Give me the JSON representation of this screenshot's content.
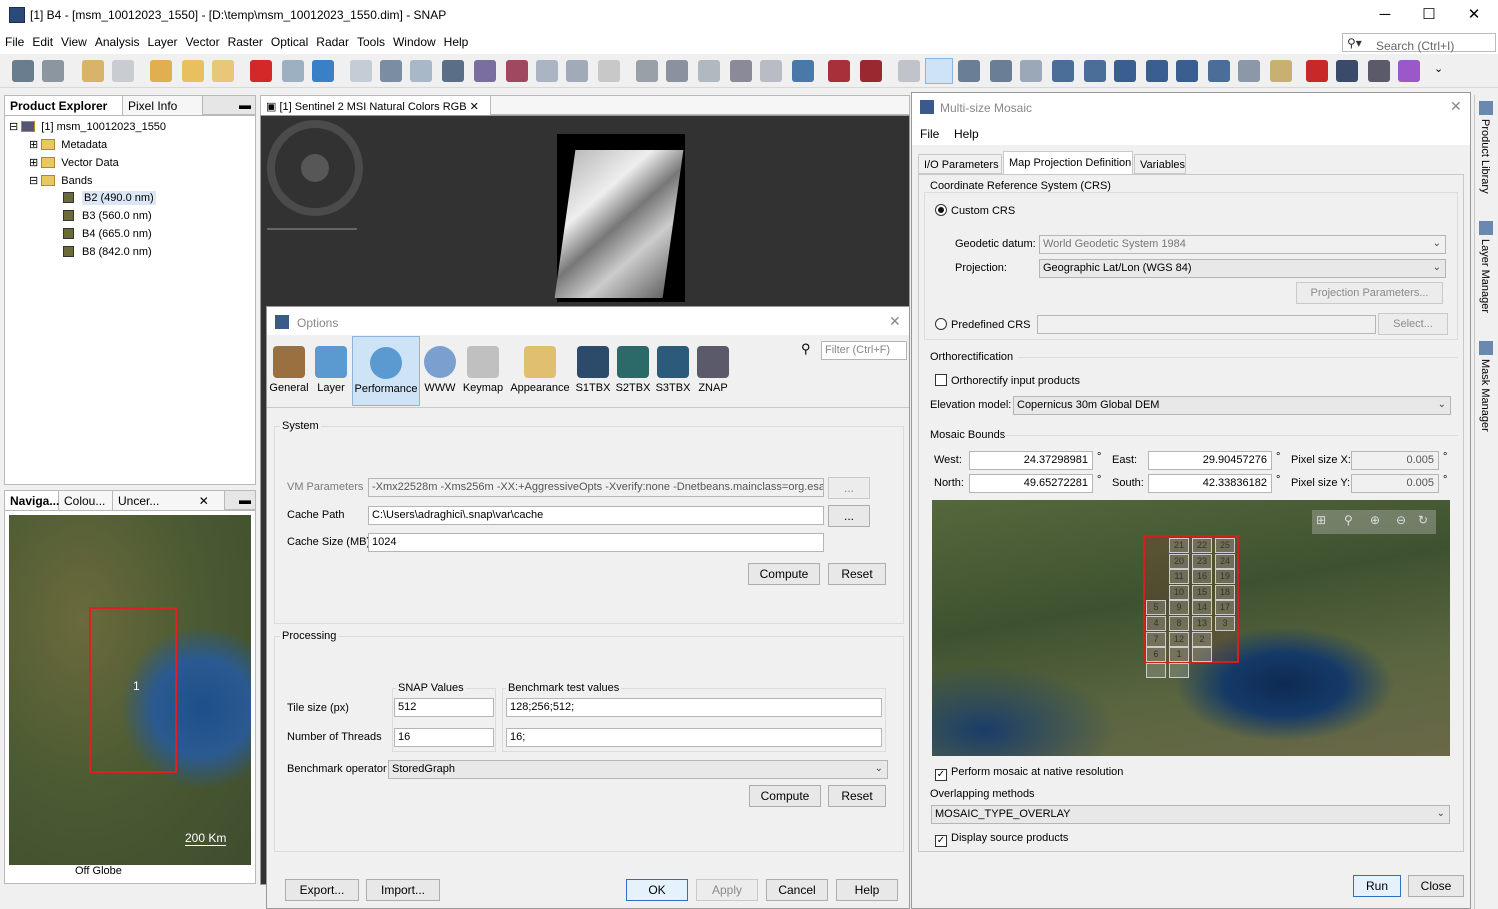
{
  "window": {
    "title": "[1] B4 - [msm_10012023_1550] - [D:\\temp\\msm_10012023_1550.dim] - SNAP",
    "minimize": "─",
    "maximize": "☐",
    "close": "✕"
  },
  "menu": [
    "File",
    "Edit",
    "View",
    "Analysis",
    "Layer",
    "Vector",
    "Raster",
    "Optical",
    "Radar",
    "Tools",
    "Window",
    "Help"
  ],
  "search": {
    "placeholder": "Search (Ctrl+I)",
    "icon": "search-icon"
  },
  "product_explorer": {
    "tabs": [
      "Product Explorer",
      "Pixel Info"
    ],
    "root": "[1] msm_10012023_1550",
    "folders": [
      "Metadata",
      "Vector Data",
      "Bands"
    ],
    "bands": [
      "B2 (490.0 nm)",
      "B3 (560.0 nm)",
      "B4 (665.0 nm)",
      "B8 (842.0 nm)"
    ]
  },
  "navigation": {
    "tabs": [
      "Naviga...",
      "Colou...",
      "Uncer..."
    ],
    "scale": "200 Km",
    "footer": "Off Globe",
    "region_label": "1"
  },
  "image_view": {
    "tab": "[1] Sentinel 2 MSI Natural Colors RGB"
  },
  "options": {
    "title": "Options",
    "filter_placeholder": "Filter (Ctrl+F)",
    "categories": [
      "General",
      "Layer",
      "Performance",
      "WWW",
      "Keymap",
      "Appearance",
      "S1TBX",
      "S2TBX",
      "S3TBX",
      "ZNAP"
    ],
    "system": {
      "title": "System",
      "vm_label": "VM Parameters",
      "vm_value": "-Xmx22528m -Xms256m -XX:+AggressiveOpts -Xverify:none -Dnetbeans.mainclass=org.esa.",
      "cache_path_label": "Cache Path",
      "cache_path_value": "C:\\Users\\adraghici\\.snap\\var\\cache",
      "cache_size_label": "Cache Size (MB)",
      "cache_size_value": "1024",
      "browse": "...",
      "compute": "Compute",
      "reset": "Reset"
    },
    "processing": {
      "title": "Processing",
      "snap_values": "SNAP Values",
      "benchmark_values": "Benchmark test values",
      "tile_label": "Tile size (px)",
      "tile_value": "512",
      "tile_bench": "128;256;512;",
      "threads_label": "Number of Threads",
      "threads_value": "16",
      "threads_bench": "16;",
      "op_label": "Benchmark operator",
      "op_value": "StoredGraph",
      "compute": "Compute",
      "reset": "Reset"
    },
    "buttons": {
      "export": "Export...",
      "import": "Import...",
      "ok": "OK",
      "apply": "Apply",
      "cancel": "Cancel",
      "help": "Help"
    }
  },
  "mosaic": {
    "title": "Multi-size Mosaic",
    "menu": [
      "File",
      "Help"
    ],
    "tabs": [
      "I/O Parameters",
      "Map Projection Definition",
      "Variables"
    ],
    "crs_title": "Coordinate Reference System (CRS)",
    "custom_crs": "Custom CRS",
    "datum_label": "Geodetic datum:",
    "datum_value": "World Geodetic System 1984",
    "proj_label": "Projection:",
    "proj_value": "Geographic Lat/Lon (WGS 84)",
    "proj_params": "Projection Parameters...",
    "predef_crs": "Predefined CRS",
    "select": "Select...",
    "ortho_title": "Orthorectification",
    "ortho_check": "Orthorectify input products",
    "elev_label": "Elevation model:",
    "elev_value": "Copernicus 30m Global DEM",
    "bounds_title": "Mosaic Bounds",
    "west_label": "West:",
    "west": "24.37298981",
    "east_label": "East:",
    "east": "29.90457276",
    "north_label": "North:",
    "north": "49.65272281",
    "south_label": "South:",
    "south": "42.33836182",
    "psx_label": "Pixel size X:",
    "psx": "0.005",
    "psy_label": "Pixel size Y:",
    "psy": "0.005",
    "deg": "°",
    "tiles": [
      "21",
      "22",
      "25",
      "20",
      "23",
      "24",
      "11",
      "16",
      "19",
      "10",
      "15",
      "18",
      "5",
      "9",
      "14",
      "17",
      "4",
      "8",
      "13",
      "3",
      "7",
      "12",
      "2",
      "6",
      "1"
    ],
    "native": "Perform mosaic at native resolution",
    "overlap_label": "Overlapping methods",
    "overlap_value": "MOSAIC_TYPE_OVERLAY",
    "display_src": "Display source products",
    "run": "Run",
    "close": "Close"
  },
  "side_tabs": [
    "Product Library",
    "Layer Manager",
    "Mask Manager"
  ],
  "colors": {
    "accent": "#2e6fc4",
    "selection": "#cfe3f6",
    "bounds": "#e02020"
  }
}
